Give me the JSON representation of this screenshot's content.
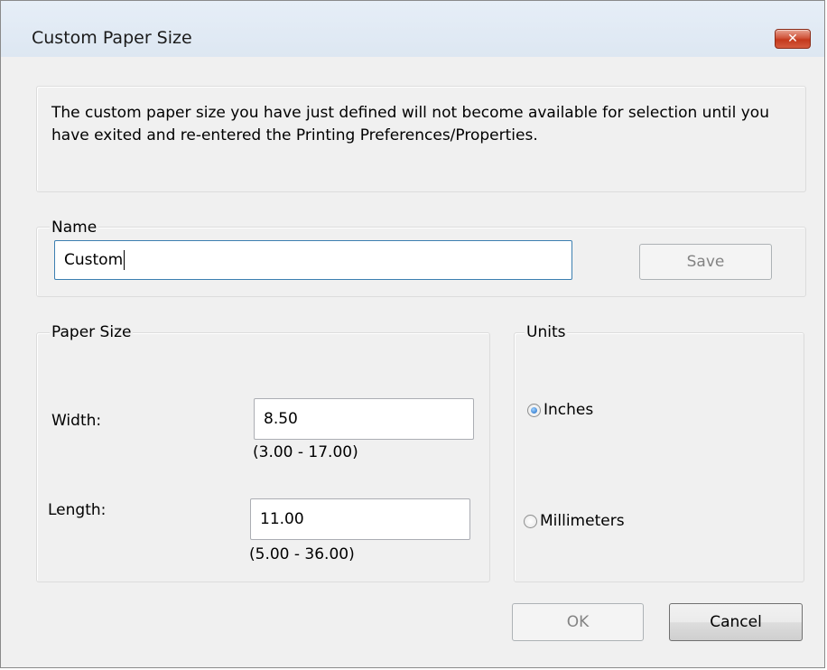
{
  "window": {
    "title": "Custom Paper Size",
    "close_glyph": "✕"
  },
  "info": {
    "message": "The custom paper size you have just defined will not become available for selection until you have exited and re-entered the Printing Preferences/Properties."
  },
  "name_group": {
    "label": "Name",
    "value": "Custom",
    "save_label": "Save"
  },
  "paper_size": {
    "label": "Paper Size",
    "width_label": "Width:",
    "width_value": "8.50",
    "width_range": "(3.00 - 17.00)",
    "length_label": "Length:",
    "length_value": "11.00",
    "length_range": "(5.00 - 36.00)"
  },
  "units": {
    "label": "Units",
    "inches_label": "Inches",
    "millimeters_label": "Millimeters",
    "selected": "Inches"
  },
  "footer": {
    "ok_label": "OK",
    "cancel_label": "Cancel"
  },
  "colors": {
    "close_button": "#c4391c",
    "focus_border": "#3c7fb1",
    "radio_selected": "#1a66c2"
  }
}
